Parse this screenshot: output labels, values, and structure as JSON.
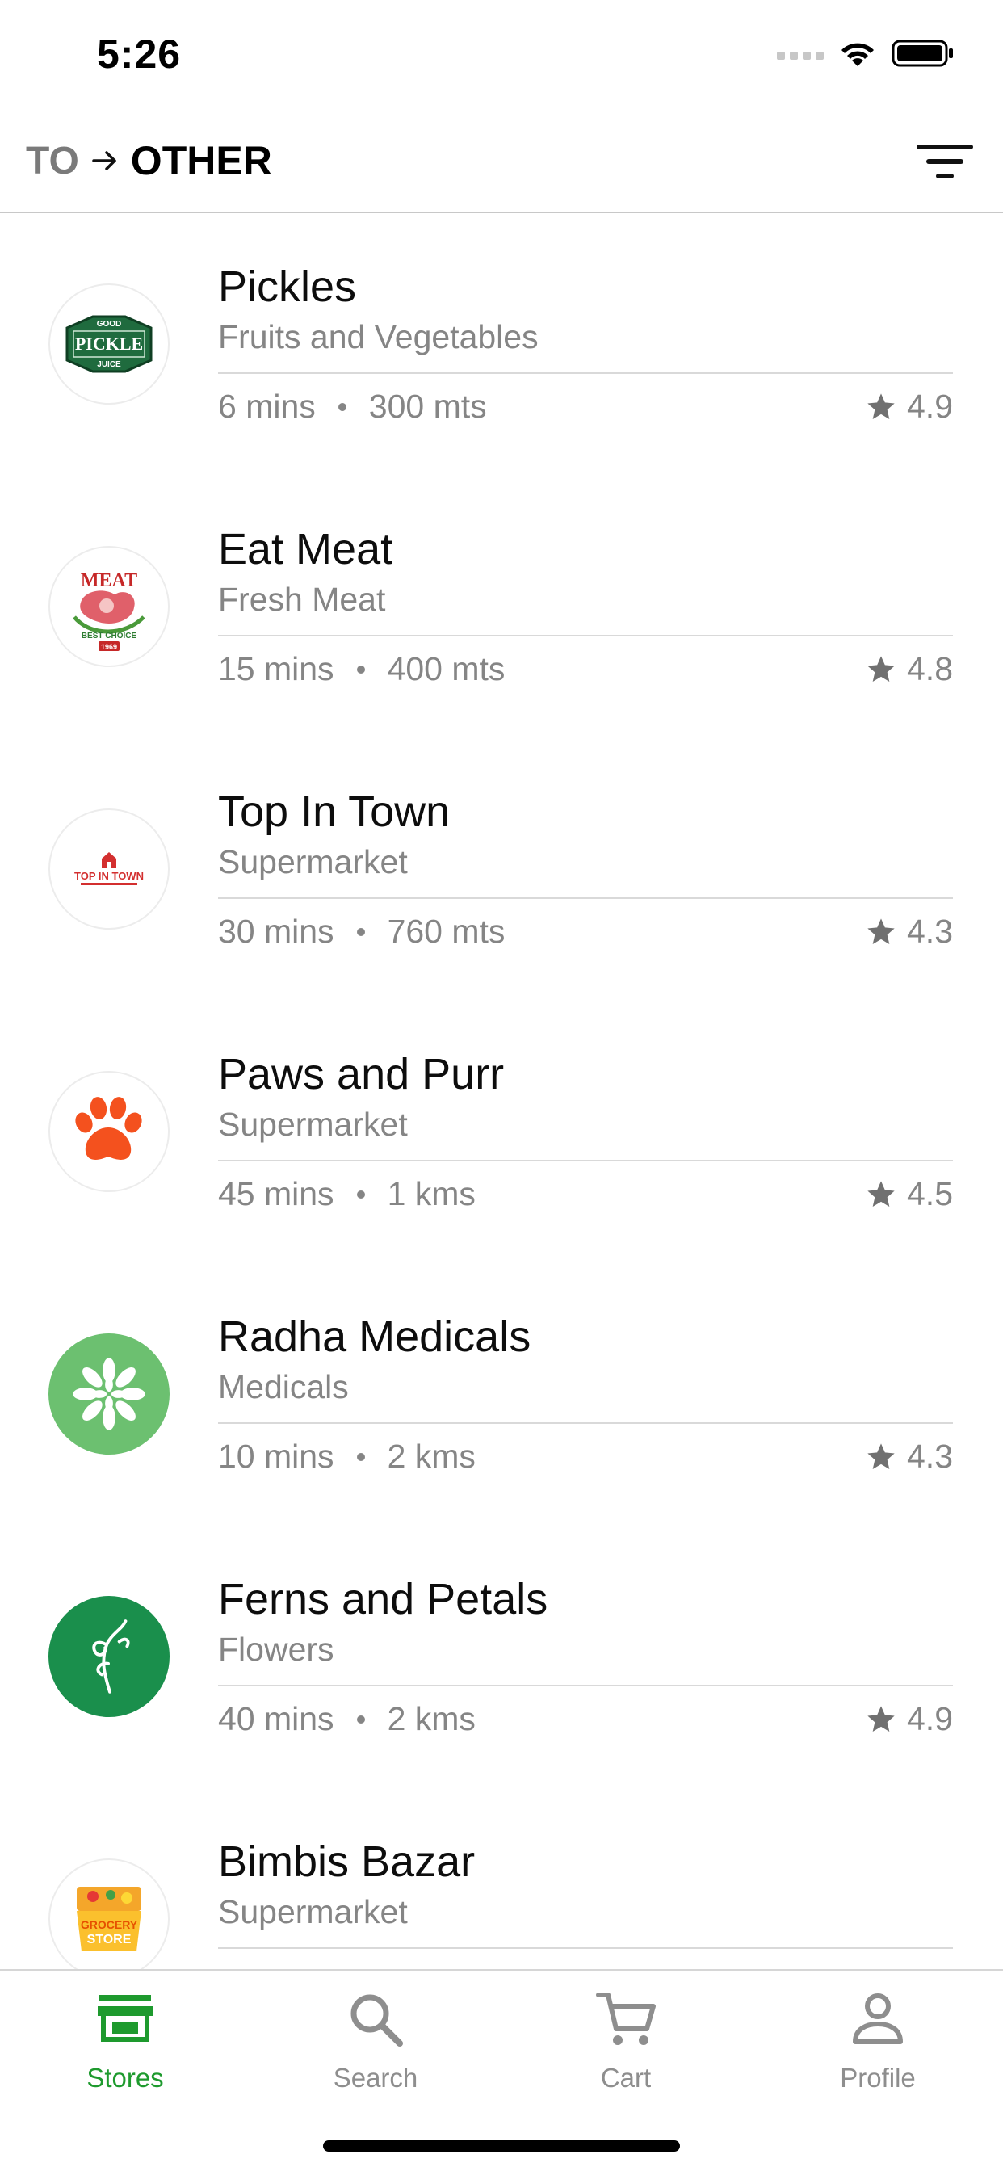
{
  "status_bar": {
    "time": "5:26"
  },
  "header": {
    "from": "TO",
    "to": "OTHER"
  },
  "stores": [
    {
      "name": "Pickles",
      "category": "Fruits and Vegetables",
      "time": "6 mins",
      "distance": "300 mts",
      "rating": "4.9",
      "logo": "good-pickle-juice-logo",
      "logo_text": [
        "GOOD",
        "PICKLE",
        "JUICE"
      ]
    },
    {
      "name": "Eat Meat",
      "category": "Fresh Meat",
      "time": "15 mins",
      "distance": "400 mts",
      "rating": "4.8",
      "logo": "meat-best-choice-logo",
      "logo_text": [
        "MEAT",
        "BEST CHOICE",
        "1969"
      ]
    },
    {
      "name": "Top In Town",
      "category": "Supermarket",
      "time": "30 mins",
      "distance": "760 mts",
      "rating": "4.3",
      "logo": "top-in-town-logo",
      "logo_text": [
        "TOP IN TOWN"
      ]
    },
    {
      "name": "Paws and Purr",
      "category": "Supermarket",
      "time": "45 mins",
      "distance": "1 kms",
      "rating": "4.5",
      "logo": "paw-print-logo"
    },
    {
      "name": "Radha Medicals",
      "category": "Medicals",
      "time": "10 mins",
      "distance": "2 kms",
      "rating": "4.3",
      "logo": "leaf-circle-logo"
    },
    {
      "name": "Ferns and Petals",
      "category": "Flowers",
      "time": "40 mins",
      "distance": "2 kms",
      "rating": "4.9",
      "logo": "ferns-petals-logo"
    },
    {
      "name": "Bimbis Bazar",
      "category": "Supermarket",
      "time": "",
      "distance": "",
      "rating": "",
      "logo": "grocery-store-logo",
      "logo_text": [
        "GROCERY",
        "STORE"
      ]
    }
  ],
  "tabs": [
    {
      "label": "Stores",
      "icon": "storefront-icon",
      "active": true
    },
    {
      "label": "Search",
      "icon": "search-icon",
      "active": false
    },
    {
      "label": "Cart",
      "icon": "cart-icon",
      "active": false
    },
    {
      "label": "Profile",
      "icon": "person-icon",
      "active": false
    }
  ],
  "colors": {
    "accent": "#1e9a2e",
    "muted_text": "#858585",
    "divider": "#d9d9d9"
  }
}
